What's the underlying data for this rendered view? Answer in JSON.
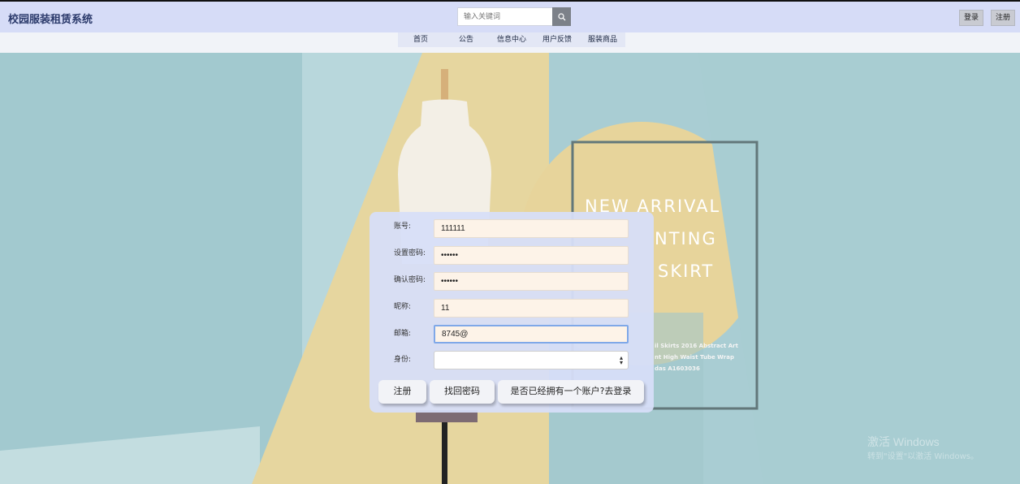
{
  "header": {
    "app_title": "校园服装租赁系统",
    "search_placeholder": "输入关键词",
    "login_label": "登录",
    "register_label": "注册"
  },
  "nav": {
    "items": [
      {
        "label": "首页"
      },
      {
        "label": "公告"
      },
      {
        "label": "信息中心"
      },
      {
        "label": "用户反馈"
      },
      {
        "label": "服装商品"
      }
    ]
  },
  "hero": {
    "promo_lines": [
      "NEW ARRIVAL",
      "NTING",
      "SKIRT"
    ],
    "promo_small": [
      "il Skirts 2016 Abstract Art",
      "nt High Waist Tube Wrap",
      "das A1603036"
    ]
  },
  "form": {
    "account_label": "账号:",
    "account_value": "111111",
    "password_label": "设置密码:",
    "password_value": "••••••",
    "confirm_label": "确认密码:",
    "confirm_value": "••••••",
    "nickname_label": "昵称:",
    "nickname_value": "11",
    "email_label": "邮箱:",
    "email_value": "8745@",
    "identity_label": "身份:",
    "identity_value": "",
    "register_button": "注册",
    "recover_button": "找回密码",
    "go_login_button": "是否已经拥有一个账户?去登录"
  },
  "watermark": {
    "line1": "激活 Windows",
    "line2": "转到\"设置\"以激活 Windows。"
  },
  "colors": {
    "topbar": "#d6dcf7",
    "field_bg": "#fdf3e8",
    "card_bg": "#d7def8"
  }
}
